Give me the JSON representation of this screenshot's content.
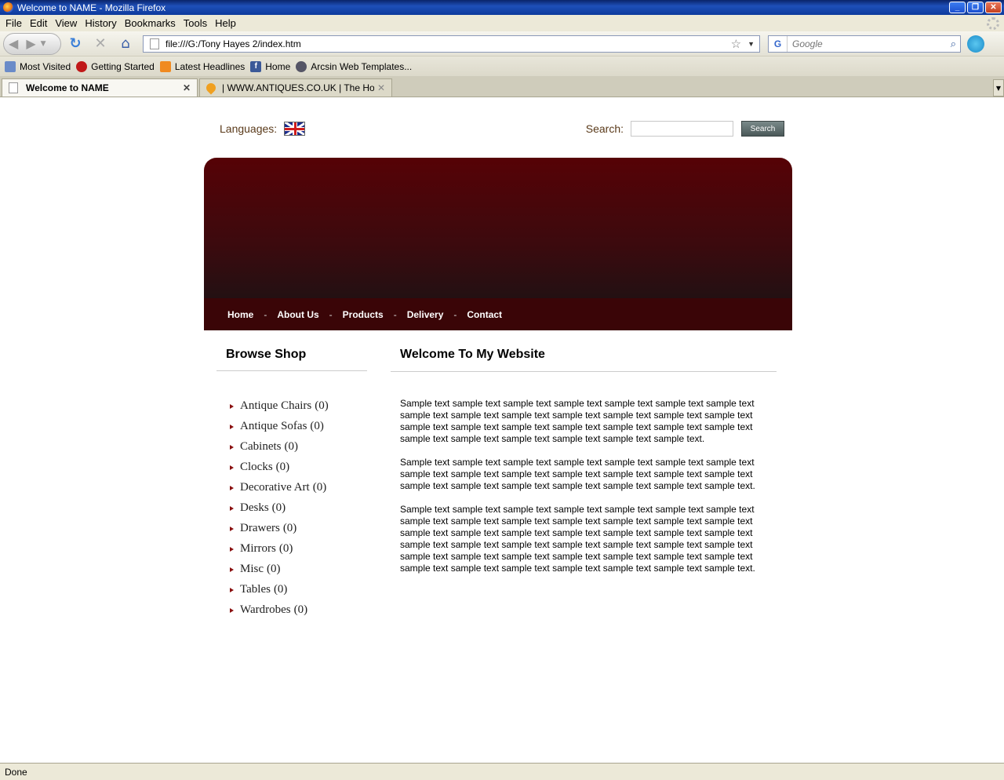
{
  "window": {
    "title": "Welcome to NAME - Mozilla Firefox"
  },
  "menu": [
    "File",
    "Edit",
    "View",
    "History",
    "Bookmarks",
    "Tools",
    "Help"
  ],
  "toolbar": {
    "url": "file:///G:/Tony Hayes 2/index.htm",
    "search_placeholder": "Google"
  },
  "bookmarks": [
    "Most Visited",
    "Getting Started",
    "Latest Headlines",
    "Home",
    "Arcsin Web Templates..."
  ],
  "tabs": [
    {
      "label": "Welcome to NAME"
    },
    {
      "label": "| WWW.ANTIQUES.CO.UK | The Ho..."
    }
  ],
  "page": {
    "languages_label": "Languages:",
    "search_label": "Search:",
    "search_button": "Search",
    "nav": [
      "Home",
      "About Us",
      "Products",
      "Delivery",
      "Contact"
    ],
    "nav_sep": "-",
    "sidebar_title": "Browse Shop",
    "categories": [
      {
        "name": "Antique Chairs",
        "count": "(0)"
      },
      {
        "name": "Antique Sofas",
        "count": "(0)"
      },
      {
        "name": "Cabinets",
        "count": "(0)"
      },
      {
        "name": "Clocks",
        "count": "(0)"
      },
      {
        "name": "Decorative Art",
        "count": "(0)"
      },
      {
        "name": "Desks",
        "count": "(0)"
      },
      {
        "name": "Drawers",
        "count": "(0)"
      },
      {
        "name": "Mirrors",
        "count": "(0)"
      },
      {
        "name": "Misc",
        "count": "(0)"
      },
      {
        "name": "Tables",
        "count": "(0)"
      },
      {
        "name": "Wardrobes",
        "count": "(0)"
      }
    ],
    "main_title": "Welcome To My Website",
    "paragraphs": [
      "Sample text sample text sample text sample text sample text sample text sample text sample text sample text sample text sample text sample text sample text sample text sample text sample text sample text sample text sample text sample text sample text sample text sample text sample text sample text sample text sample text.",
      "Sample text sample text sample text sample text sample text sample text sample text sample text sample text sample text sample text sample text sample text sample text sample text sample text sample text sample text sample text sample text sample text.",
      "Sample text sample text sample text sample text sample text sample text sample text sample text sample text sample text sample text sample text sample text sample text sample text sample text sample text sample text sample text sample text sample text sample text sample text sample text sample text sample text sample text sample text sample text sample text sample text sample text sample text sample text sample text sample text sample text sample text sample text sample text sample text sample text."
    ]
  },
  "status": "Done",
  "colors": {
    "header_top": "#560206",
    "nav_bg": "#3a0507",
    "bullet": "#8a1010"
  }
}
